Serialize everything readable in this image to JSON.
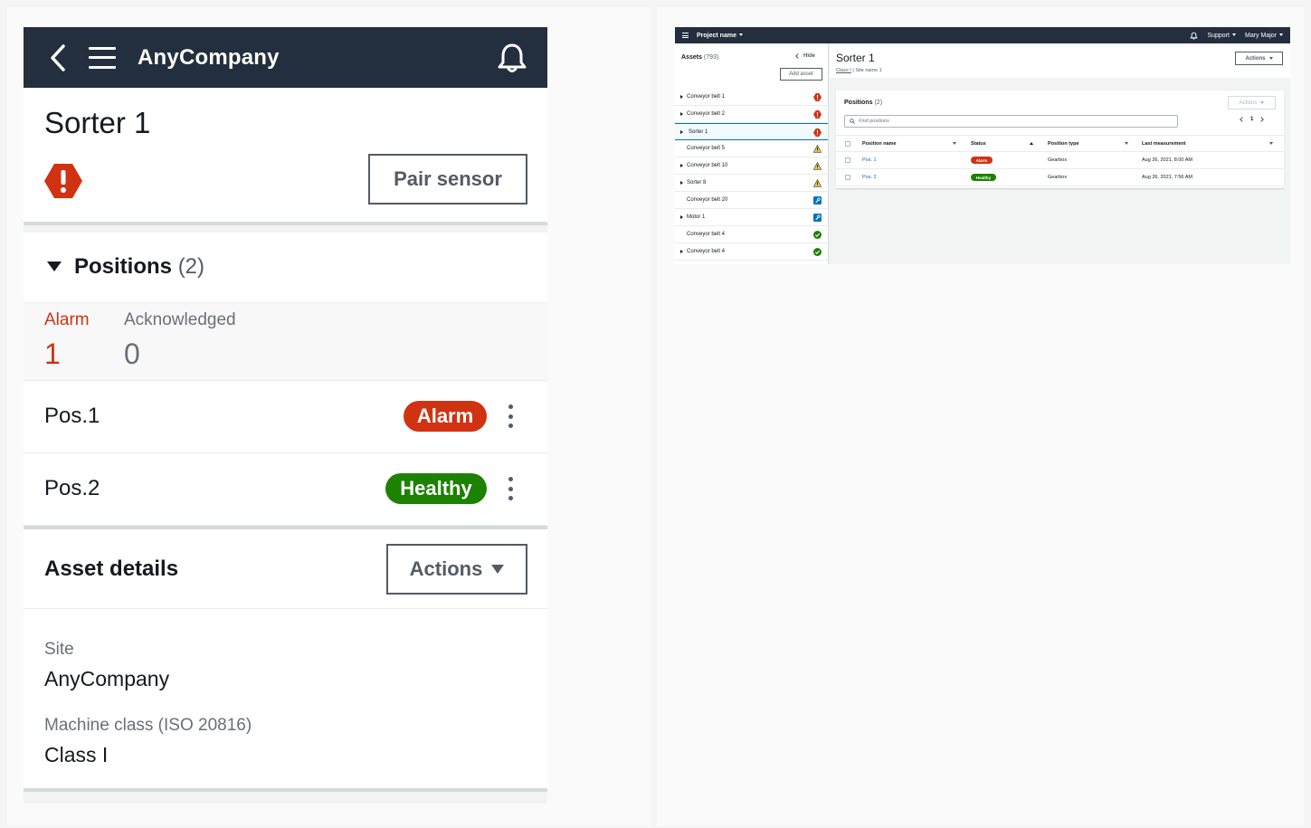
{
  "mobile": {
    "brand": "AnyCompany",
    "title": "Sorter 1",
    "pair_sensor_label": "Pair sensor",
    "positions": {
      "label": "Positions",
      "count": "(2)",
      "alarm_label": "Alarm",
      "alarm_value": "1",
      "ack_label": "Acknowledged",
      "ack_value": "0",
      "rows": [
        {
          "name": "Pos.1",
          "status": "Alarm"
        },
        {
          "name": "Pos.2",
          "status": "Healthy"
        }
      ]
    },
    "asset_details": {
      "title": "Asset details",
      "actions_label": "Actions",
      "site_label": "Site",
      "site_value": "AnyCompany",
      "class_label": "Machine class (ISO 20816)",
      "class_value": "Class I"
    }
  },
  "desktop": {
    "top_nav": {
      "project": "Project name",
      "support": "Support",
      "user": "Mary Major"
    },
    "sidebar": {
      "title": "Assets",
      "count": "(793)",
      "hide_label": "Hide",
      "add_label": "Add asset",
      "items": [
        {
          "label": "Conveyor belt 1",
          "status": "alarm"
        },
        {
          "label": "Conveyor belt 2",
          "status": "alarm"
        },
        {
          "label": "Sorter 1",
          "status": "alarm"
        },
        {
          "label": "Conveyor belt 5",
          "status": "warning"
        },
        {
          "label": "Conveyor belt 10",
          "status": "warning"
        },
        {
          "label": "Sorter 8",
          "status": "warning"
        },
        {
          "label": "Conveyor belt 20",
          "status": "maintenance"
        },
        {
          "label": "Motor 1",
          "status": "maintenance"
        },
        {
          "label": "Conveyor belt 4",
          "status": "healthy"
        },
        {
          "label": "Conveyor belt 4",
          "status": "healthy"
        }
      ]
    },
    "header": {
      "title": "Sorter 1",
      "breadcrumb_class": "Class I",
      "breadcrumb_site": "Site name 1",
      "actions_label": "Actions"
    },
    "positions_card": {
      "title": "Positions",
      "count": "(2)",
      "actions_label": "Actions",
      "search_placeholder": "Find positions",
      "page": "1",
      "columns": [
        "Position name",
        "Status",
        "Position type",
        "Last measurement"
      ],
      "rows": [
        {
          "name": "Pos. 1",
          "status": "Alarm",
          "type": "Gearbox",
          "last": "Aug 26, 2021, 8:00 AM"
        },
        {
          "name": "Pos. 2",
          "status": "Healthy",
          "type": "Gearbox",
          "last": "Aug 26, 2021, 7:56 AM"
        }
      ]
    }
  },
  "colors": {
    "nav_dark": "#232f3e",
    "alarm": "#d13212",
    "healthy": "#1d8102",
    "warning": "#f2c94c",
    "maintenance": "#0073bb",
    "link": "#0073bb"
  }
}
